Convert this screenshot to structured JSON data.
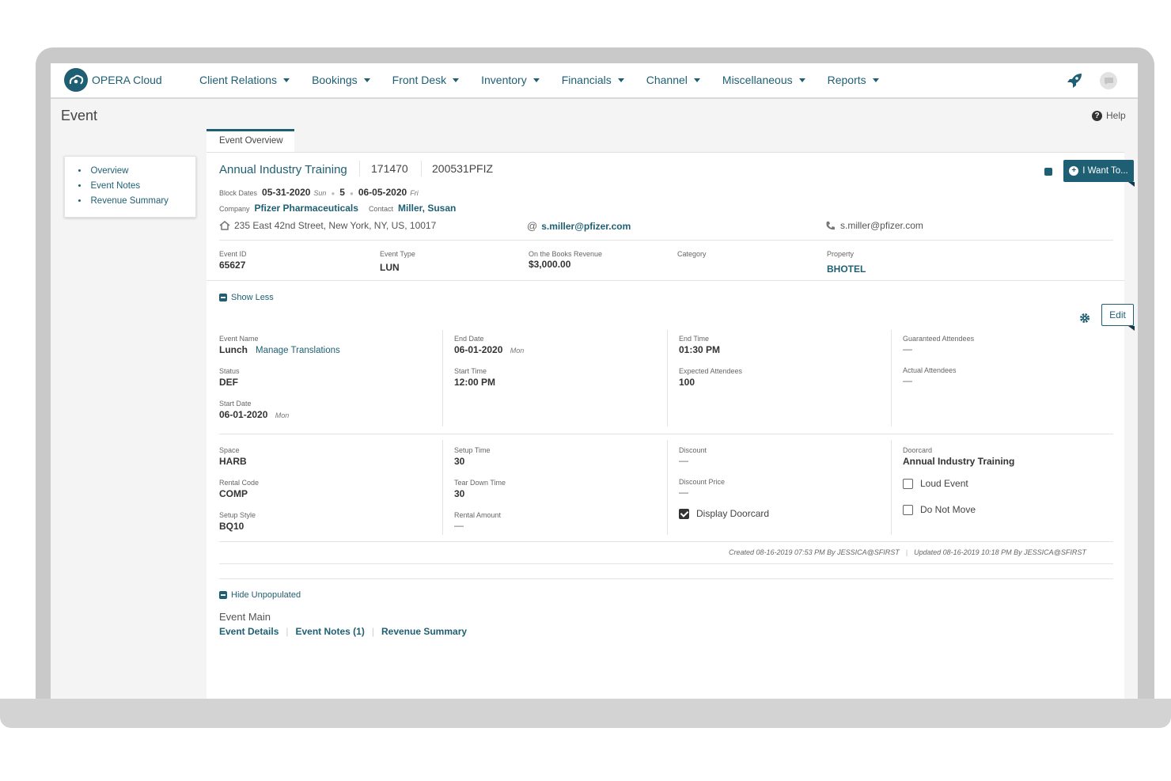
{
  "app": {
    "logo_text": "OPERA Cloud"
  },
  "nav": {
    "items": [
      "Client Relations",
      "Bookings",
      "Front Desk",
      "Inventory",
      "Financials",
      "Channel",
      "Miscellaneous",
      "Reports"
    ]
  },
  "page": {
    "title": "Event",
    "help": "Help"
  },
  "leftnav": {
    "items": [
      "Overview",
      "Event Notes",
      "Revenue Summary"
    ]
  },
  "tabs": {
    "active": "Event Overview"
  },
  "header": {
    "event_name": "Annual Industry Training",
    "block_id": "171470",
    "block_code": "200531PFIZ",
    "block_dates_label": "Block Dates",
    "start_date": "05-31-2020",
    "start_day": "Sun",
    "nights": "5",
    "end_date": "06-05-2020",
    "end_day": "Fri",
    "company_label": "Company",
    "company": "Pfizer Pharmaceuticals",
    "contact_label": "Contact",
    "contact": "Miller, Susan",
    "address": "235 East 42nd Street, New York, NY, US, 10017",
    "email": "s.miller@pfizer.com",
    "phone": "s.miller@pfizer.com",
    "want_button": "I Want To..."
  },
  "summary": {
    "event_id_label": "Event ID",
    "event_id": "65627",
    "event_type_label": "Event Type",
    "event_type": "LUN",
    "revenue_label": "On the Books Revenue",
    "revenue": "$3,000.00",
    "category_label": "Category",
    "property_label": "Property",
    "property": "BHOTEL"
  },
  "details": {
    "show_less": "Show Less",
    "edit": "Edit",
    "event_name_label": "Event Name",
    "event_name": "Lunch",
    "manage_translations": "Manage Translations",
    "status_label": "Status",
    "status": "DEF",
    "start_date_label": "Start Date",
    "start_date": "06-01-2020",
    "start_day": "Mon",
    "end_date_label": "End Date",
    "end_date": "06-01-2020",
    "end_day": "Mon",
    "start_time_label": "Start Time",
    "start_time": "12:00 PM",
    "end_time_label": "End Time",
    "end_time": "01:30 PM",
    "expected_label": "Expected Attendees",
    "expected": "100",
    "guaranteed_label": "Guaranteed Attendees",
    "guaranteed": "—",
    "actual_label": "Actual Attendees",
    "actual": "—",
    "space_label": "Space",
    "space": "HARB",
    "rental_code_label": "Rental Code",
    "rental_code": "COMP",
    "setup_style_label": "Setup Style",
    "setup_style": "BQ10",
    "setup_time_label": "Setup Time",
    "setup_time": "30",
    "teardown_label": "Tear Down Time",
    "teardown": "30",
    "rental_amount_label": "Rental Amount",
    "rental_amount": "—",
    "discount_label": "Discount",
    "discount": "—",
    "discount_price_label": "Discount Price",
    "discount_price": "—",
    "display_doorcard": "Display Doorcard",
    "doorcard_label": "Doorcard",
    "doorcard": "Annual Industry Training",
    "loud_event": "Loud Event",
    "do_not_move": "Do Not Move",
    "created": "Created 08-16-2019 07:53 PM By JESSICA@SFIRST",
    "updated": "Updated 08-16-2019 10:18 PM By JESSICA@SFIRST"
  },
  "bottom": {
    "hide_unpopulated": "Hide Unpopulated",
    "section_title": "Event Main",
    "links": [
      "Event Details",
      "Event Notes (1)",
      "Revenue Summary"
    ]
  },
  "colors": {
    "brand": "#1e5f73"
  }
}
